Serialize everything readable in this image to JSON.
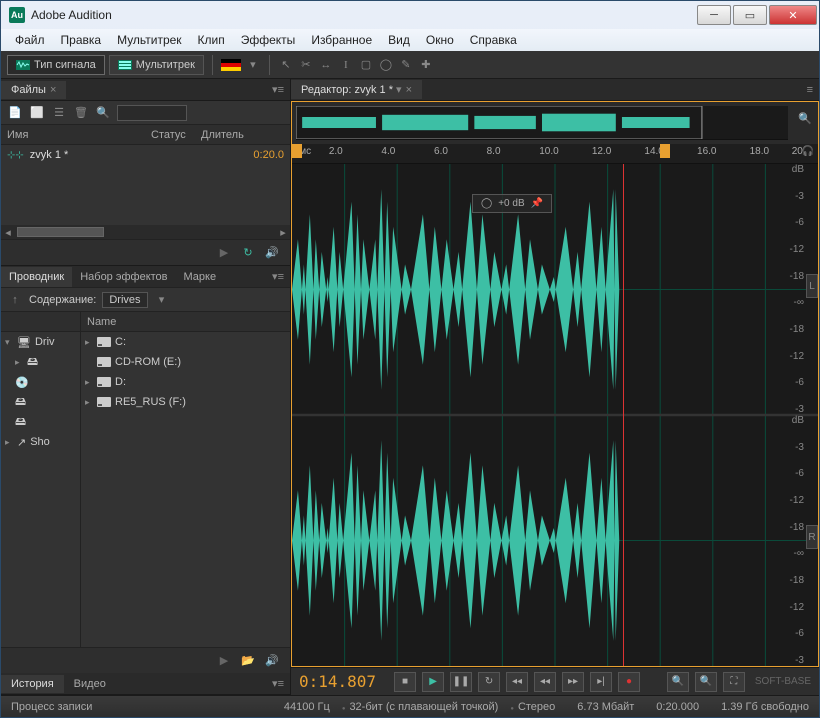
{
  "window": {
    "title": "Adobe Audition"
  },
  "menu": [
    "Файл",
    "Правка",
    "Мультитрек",
    "Клип",
    "Эффекты",
    "Избранное",
    "Вид",
    "Окно",
    "Справка"
  ],
  "toolbar": {
    "waveform": "Тип сигнала",
    "multitrack": "Мультитрек"
  },
  "files_panel": {
    "tab": "Файлы",
    "cols": {
      "name": "Имя",
      "status": "Статус",
      "duration": "Длитель"
    },
    "items": [
      {
        "name": "zvyk 1 *",
        "duration": "0:20.0"
      }
    ]
  },
  "explorer": {
    "tabs": [
      "Проводник",
      "Набор эффектов",
      "Марке"
    ],
    "path_label": "Содержание:",
    "path_value": "Drives",
    "tree": [
      "Driv",
      "Sho"
    ],
    "list_header": "Name",
    "drives": [
      "C:",
      "CD-ROM (E:)",
      "D:",
      "RE5_RUS (F:)"
    ]
  },
  "bottom_tabs": [
    "История",
    "Видео"
  ],
  "editor": {
    "tab": "Редактор: zvyk 1 *",
    "time_unit": "чмс",
    "ticks": [
      "2.0",
      "4.0",
      "6.0",
      "8.0",
      "10.0",
      "12.0",
      "14.0",
      "16.0",
      "18.0",
      "20"
    ],
    "db_labels": [
      "dB",
      "-3",
      "-6",
      "-12",
      "-18",
      "-∞",
      "-18",
      "-12",
      "-6",
      "-3"
    ],
    "hud": "+0 dB",
    "channels": [
      "L",
      "R"
    ]
  },
  "transport": {
    "timecode": "0:14.807"
  },
  "status": {
    "process": "Процесс записи",
    "sr": "44100 Гц",
    "bit": "32-бит (с плавающей точкой)",
    "ch": "Стерео",
    "mem": "6.73 Мбайт",
    "dur": "0:20.000",
    "disk": "1.39 Гб свободно"
  },
  "watermark": "SOFT-BASE"
}
